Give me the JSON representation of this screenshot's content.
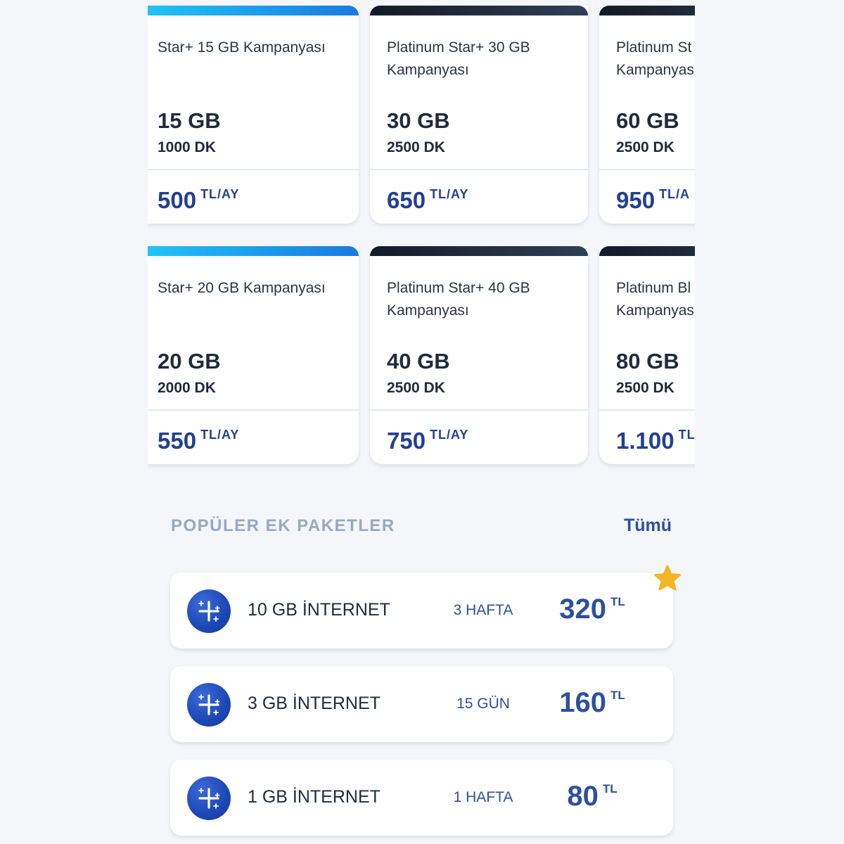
{
  "campaigns": {
    "row1": [
      {
        "title": "Star+ 15 GB Kampanyası",
        "data": "15 GB",
        "minutes": "1000 DK",
        "price": "500",
        "unit": "TL/AY"
      },
      {
        "title": "Platinum Star+ 30 GB\nKampanyası",
        "data": "30 GB",
        "minutes": "2500 DK",
        "price": "650",
        "unit": "TL/AY"
      },
      {
        "title": "Platinum St\nKampanyas",
        "data": "60 GB",
        "minutes": "2500 DK",
        "price": "950",
        "unit": "TL/A"
      }
    ],
    "row2": [
      {
        "title": "Star+ 20 GB Kampanyası",
        "data": "20 GB",
        "minutes": "2000 DK",
        "price": "550",
        "unit": "TL/AY"
      },
      {
        "title": "Platinum Star+ 40 GB\nKampanyası",
        "data": "40 GB",
        "minutes": "2500 DK",
        "price": "750",
        "unit": "TL/AY"
      },
      {
        "title": "Platinum Bl\nKampanyas",
        "data": "80 GB",
        "minutes": "2500 DK",
        "price": "1.100",
        "unit": "TL"
      }
    ]
  },
  "addons": {
    "section_title": "POPÜLER EK PAKETLER",
    "see_all": "Tümü",
    "items": [
      {
        "name": "10 GB İNTERNET",
        "duration": "3 HAFTA",
        "price": "320",
        "unit": "TL",
        "icon": "sparkle-plus-icon",
        "featured": true
      },
      {
        "name": "3 GB İNTERNET",
        "duration": "15 GÜN",
        "price": "160",
        "unit": "TL",
        "icon": "sparkle-plus-icon"
      },
      {
        "name": "1 GB İNTERNET",
        "duration": "1 HAFTA",
        "price": "80",
        "unit": "TL",
        "icon": "sparkle-plus-icon"
      }
    ]
  },
  "colors": {
    "accent": "#2d4f9e",
    "star_gradient": [
      "#20c3f7",
      "#1a7ae0"
    ],
    "platinum_gradient": [
      "#141a26",
      "#2f3f57"
    ],
    "featured_star": "#f2b622"
  }
}
